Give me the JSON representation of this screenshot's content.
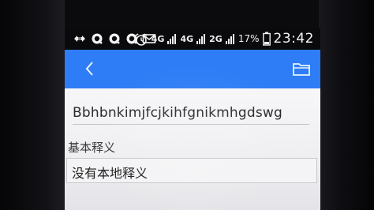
{
  "status_bar": {
    "network_1": "4G",
    "network_2": "4G",
    "network_3": "2G",
    "battery": "17%",
    "time": "23:42",
    "icons": [
      "usb-icon",
      "qq-icon",
      "qq-icon",
      "qq-icon",
      "mail-icon",
      "alarm-icon",
      "signal-icon",
      "battery-icon"
    ]
  },
  "toolbar": {
    "color": "#2e7df6",
    "back_icon": "chevron-left-icon",
    "folder_icon": "folder-icon"
  },
  "entry": {
    "word": "Bbhbnkimjfcjkihfgnikmhgdswg",
    "section_label": "基本释义",
    "definition": "没有本地释义"
  }
}
